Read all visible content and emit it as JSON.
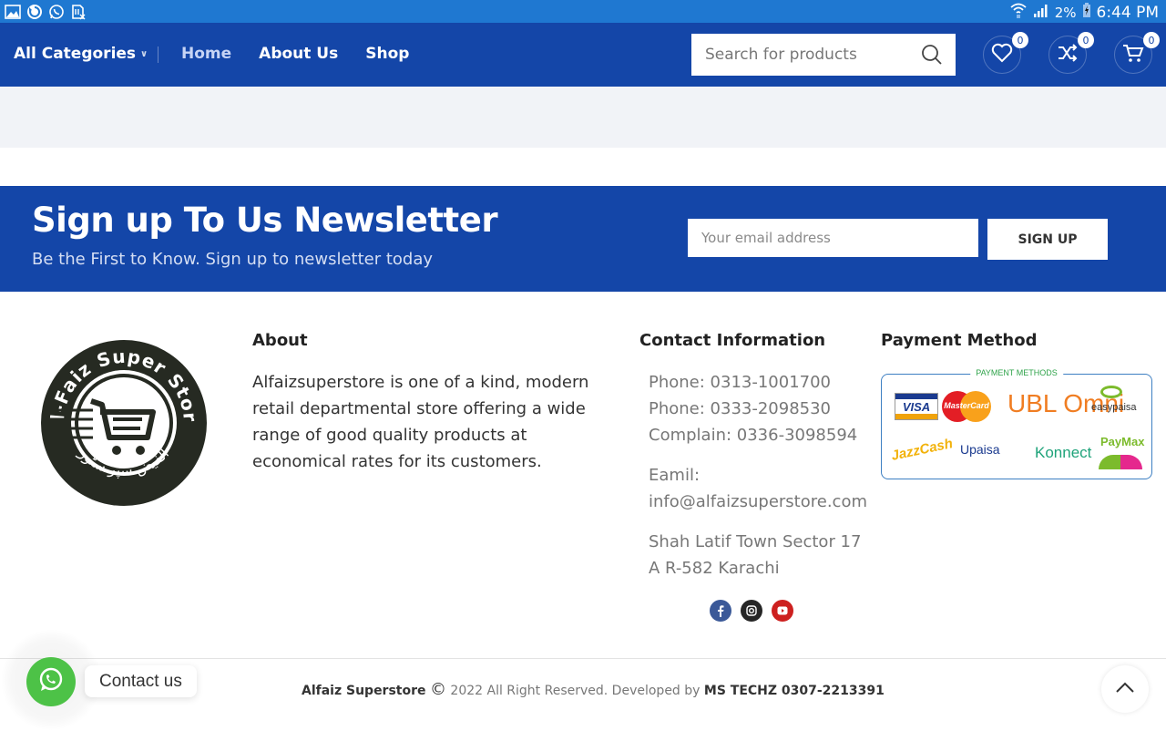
{
  "status_bar": {
    "left_icons": [
      "gallery-icon",
      "sync-icon",
      "whatsapp-icon",
      "sim-off-icon"
    ],
    "battery": "2%",
    "time": "6:44 PM"
  },
  "header": {
    "all_categories": "All Categories",
    "nav": [
      {
        "label": "Home",
        "active": true
      },
      {
        "label": "About Us",
        "active": false
      },
      {
        "label": "Shop",
        "active": false
      }
    ],
    "search_placeholder": "Search for products",
    "wishlist_count": "0",
    "compare_count": "0",
    "cart_count": "0"
  },
  "newsletter": {
    "title": "Sign up To Us Newsletter",
    "subtitle": "Be the First to Know. Sign up to newsletter today",
    "email_placeholder": "Your email address",
    "button": "SIGN UP"
  },
  "footer": {
    "logo": {
      "text_top": "Al-Faiz Super Store",
      "text_bottom": "الفیض سپر سٹور"
    },
    "about": {
      "heading": "About",
      "text": "Alfaizsuperstore is one of a kind, modern retail departmental store offering a wide range of good quality products at economical rates for its customers."
    },
    "contact": {
      "heading": "Contact Information",
      "phone1": "Phone: 0313-1001700",
      "phone2": "Phone: 0333-2098530",
      "complain": "Complain: 0336-3098594",
      "email_label": "Eamil:",
      "email": "info@alfaizsuperstore.com",
      "address1": "Shah Latif Town Sector 17",
      "address2": "A R-582 Karachi"
    },
    "payment": {
      "heading": "Payment Method",
      "box_label": "PAYMENT METHODS",
      "methods": [
        "VISA",
        "MasterCard",
        "UBL Omni",
        "easypaisa",
        "JazzCash",
        "Upaisa",
        "Konnect",
        "PayMax"
      ]
    },
    "socials": [
      "facebook",
      "instagram",
      "youtube"
    ],
    "copyright": {
      "brand": "Alfaiz Superstore",
      "symbol": "©",
      "text": " 2022 All Right Reserved. Developed by ",
      "developer": "MS TECHZ 0307-2213391"
    }
  },
  "floating": {
    "whatsapp_label": "Contact us"
  },
  "colors": {
    "primary": "#1446a8",
    "status_bar": "#1f78d1",
    "whatsapp": "#4dc247",
    "facebook": "#3b5998",
    "instagram": "#262626",
    "youtube": "#cd201f"
  }
}
